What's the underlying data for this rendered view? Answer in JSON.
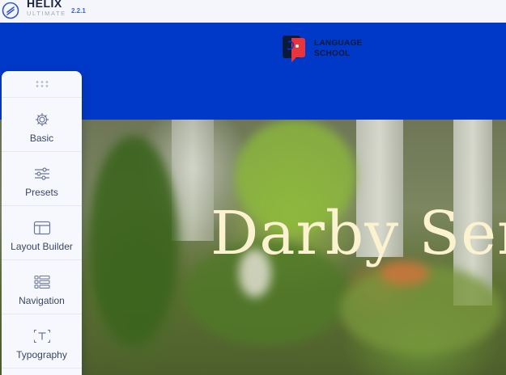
{
  "topbar": {
    "brand_name": "HELIX",
    "brand_sub": "ULTIMATE",
    "version": "2.2.1"
  },
  "site": {
    "logo_line1": "LANGUAGE",
    "logo_line2": "SCHOOL"
  },
  "hero": {
    "title": "Darby Ser"
  },
  "panel": {
    "items": [
      {
        "label": "Basic",
        "icon": "gear-icon"
      },
      {
        "label": "Presets",
        "icon": "sliders-icon"
      },
      {
        "label": "Layout Builder",
        "icon": "layout-icon"
      },
      {
        "label": "Navigation",
        "icon": "menu-list-icon"
      },
      {
        "label": "Typography",
        "icon": "text-icon"
      }
    ]
  },
  "colors": {
    "header_blue": "#0038c7",
    "panel_bg": "#f6f8fd",
    "brand_accent": "#3b63d6",
    "hero_title": "#fbf3cf"
  }
}
